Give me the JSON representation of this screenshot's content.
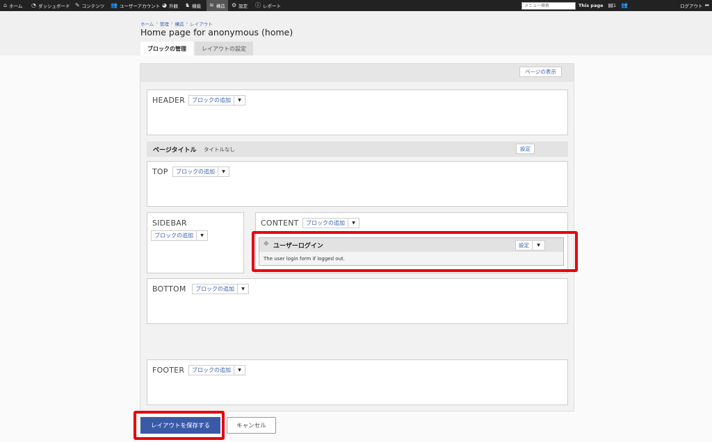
{
  "adminbar": {
    "items": [
      {
        "label": "ホーム",
        "icon": "home-icon",
        "glyph": "⌂"
      },
      {
        "label": "ダッシュボード",
        "icon": "dashboard-icon",
        "glyph": "◔"
      },
      {
        "label": "コンテンツ",
        "icon": "pencil-icon",
        "glyph": "✎"
      },
      {
        "label": "ユーザーアカウント",
        "icon": "users-icon",
        "glyph": "👥"
      },
      {
        "label": "外観",
        "icon": "palette-icon",
        "glyph": "◕"
      },
      {
        "label": "機能",
        "icon": "puzzle-icon",
        "glyph": "♞"
      },
      {
        "label": "構造",
        "icon": "layers-icon",
        "glyph": "≋"
      },
      {
        "label": "設定",
        "icon": "gear-icon",
        "glyph": "⚙"
      },
      {
        "label": "レポート",
        "icon": "info-icon",
        "glyph": "ⓘ"
      }
    ],
    "search_placeholder": "メニュー検索",
    "this_page_label": "This page",
    "user_count": "1",
    "logout_label": "ログアウト"
  },
  "breadcrumb": [
    "ホーム",
    "管理",
    "構造",
    "レイアウト"
  ],
  "page_title": "Home page for anonymous (home)",
  "tabs": [
    {
      "label": "ブロックの管理",
      "active": true
    },
    {
      "label": "レイアウトの設定",
      "active": false
    }
  ],
  "layout": {
    "view_page_label": "ページの表示",
    "add_block_label": "ブロックの追加",
    "page_title_bar": {
      "label": "ページタイトル",
      "value": "タイトルなし",
      "configure_label": "設定"
    },
    "regions": {
      "header": "HEADER",
      "top": "TOP",
      "sidebar": "SIDEBAR",
      "content": "CONTENT",
      "bottom": "BOTTOM",
      "footer": "FOOTER"
    },
    "block": {
      "title": "ユーザーログイン",
      "description": "The user login form if logged out.",
      "configure_label": "設定"
    }
  },
  "actions": {
    "save_label": "レイアウトを保存する",
    "cancel_label": "キャンセル"
  },
  "colors": {
    "primary": "#3a5aa8",
    "highlight": "#e8000e",
    "adminbar": "#222222"
  }
}
